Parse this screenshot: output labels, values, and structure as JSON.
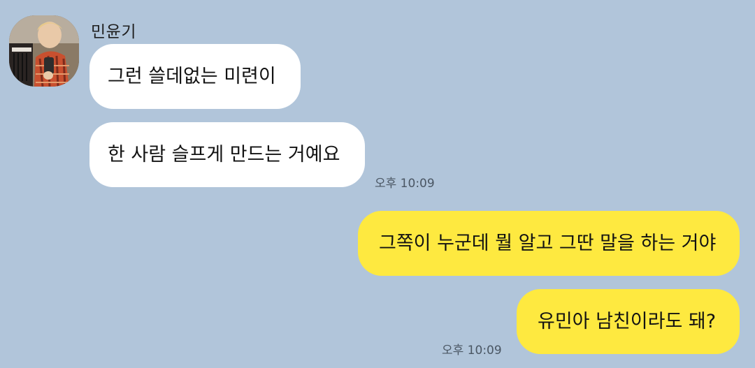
{
  "contact": {
    "name": "민윤기"
  },
  "messages": [
    {
      "direction": "incoming",
      "text": "그런 쓸데없는 미련이"
    },
    {
      "direction": "incoming",
      "text": "한 사람 슬프게 만드는 거예요",
      "time": "오후 10:09"
    },
    {
      "direction": "outgoing",
      "text": "그쪽이 누군데 뭘 알고 그딴 말을 하는 거야"
    },
    {
      "direction": "outgoing",
      "text": "유민아 남친이라도 돼?",
      "time": "오후 10:09"
    }
  ],
  "colors": {
    "background": "#b1c5da",
    "incoming_bubble": "#ffffff",
    "outgoing_bubble": "#fee940",
    "timestamp": "#4a5663"
  }
}
